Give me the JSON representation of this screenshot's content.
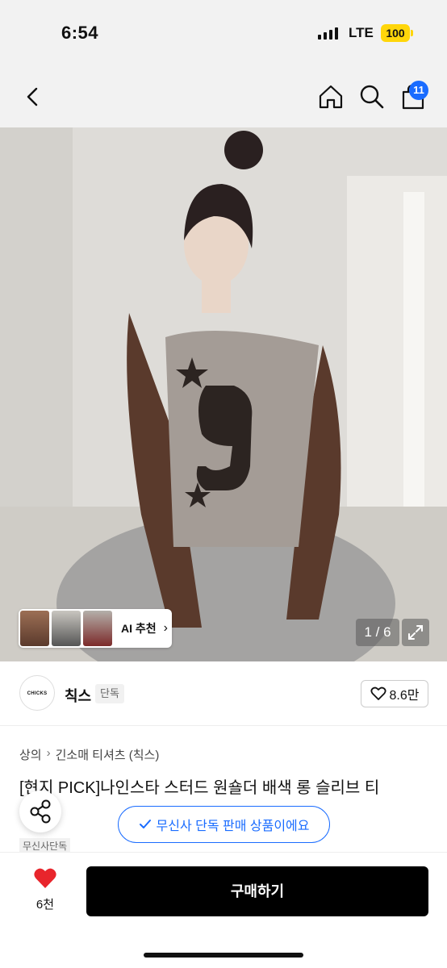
{
  "status_bar": {
    "time": "6:54",
    "network": "LTE",
    "battery": "100"
  },
  "nav": {
    "cart_count": "11"
  },
  "gallery": {
    "counter": "1 / 6",
    "ai_label": "AI 추천"
  },
  "brand": {
    "logo_text": "CHICKS",
    "name": "칙스",
    "badge": "단독",
    "likes": "8.6만"
  },
  "breadcrumb": {
    "category": "상의",
    "subcategory": "긴소매 티셔츠 (칙스)"
  },
  "product": {
    "title": "[현지 PICK]나인스타 스터드 원숄더 배색 롱 슬리브 티",
    "tag": "무신사단독"
  },
  "toast": {
    "text": "무신사 단독 판매 상품이에요"
  },
  "bottom_bar": {
    "wish_count": "6천",
    "buy_label": "구매하기"
  },
  "colors": {
    "accent": "#1a6cff",
    "heart": "#e8252c",
    "buy_button": "#000000"
  }
}
